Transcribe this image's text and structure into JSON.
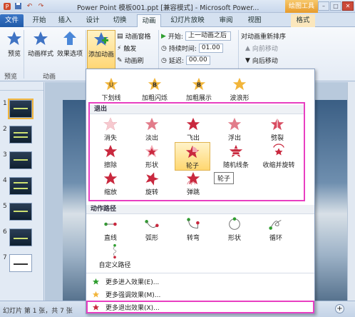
{
  "title_bar": {
    "title": "Power Point  模板001.ppt [兼容模式] - Microsoft Power...",
    "drawing_tools": "绘图工具",
    "window_buttons": [
      "–",
      "□",
      "✕"
    ]
  },
  "tabs": [
    "文件",
    "开始",
    "插入",
    "设计",
    "切换",
    "动画",
    "幻灯片放映",
    "审阅",
    "视图",
    "格式"
  ],
  "ribbon": {
    "preview": "预览",
    "preview_group": "预览",
    "animation_styles": "动画样式",
    "effect_options": "效果选项",
    "animation_group": "动画",
    "add_animation": "添加动画",
    "animation_pane": "动画窗格",
    "trigger": "触发",
    "animation_painter": "动画刷",
    "start_label": "开始:",
    "start_value": "上一动画之后",
    "duration_label": "持续时间:",
    "duration_value": "01.00",
    "delay_label": "延迟:",
    "delay_value": "00.00",
    "reorder_title": "对动画重新排序",
    "move_earlier": "向前移动",
    "move_later": "向后移动"
  },
  "emphasis_row": [
    "下划线",
    "加粗闪烁",
    "加粗展示",
    "波浪形"
  ],
  "exit_section": {
    "header": "退出",
    "items": [
      "消失",
      "淡出",
      "飞出",
      "浮出",
      "劈裂",
      "擦除",
      "形状",
      "轮子",
      "随机线条",
      "收缩并旋转",
      "缩放",
      "旋转",
      "弹跳"
    ]
  },
  "tooltip": "轮子",
  "motion_path_section": {
    "header": "动作路径",
    "items": [
      "直线",
      "弧形",
      "转弯",
      "形状",
      "循环",
      "自定义路径"
    ]
  },
  "more_effects": [
    "更多进入效果(E)...",
    "更多强调效果(M)...",
    "更多退出效果(X)..."
  ],
  "slide_numbers": [
    "1",
    "2",
    "3",
    "4",
    "5",
    "6",
    "7"
  ],
  "status_bar": {
    "text": "幻灯片 第 1 张，共 7 张"
  },
  "colors": {
    "accent": "#e83fc1",
    "file_tab": "#2a66b6",
    "drawing_tools": "#e79b2c"
  }
}
